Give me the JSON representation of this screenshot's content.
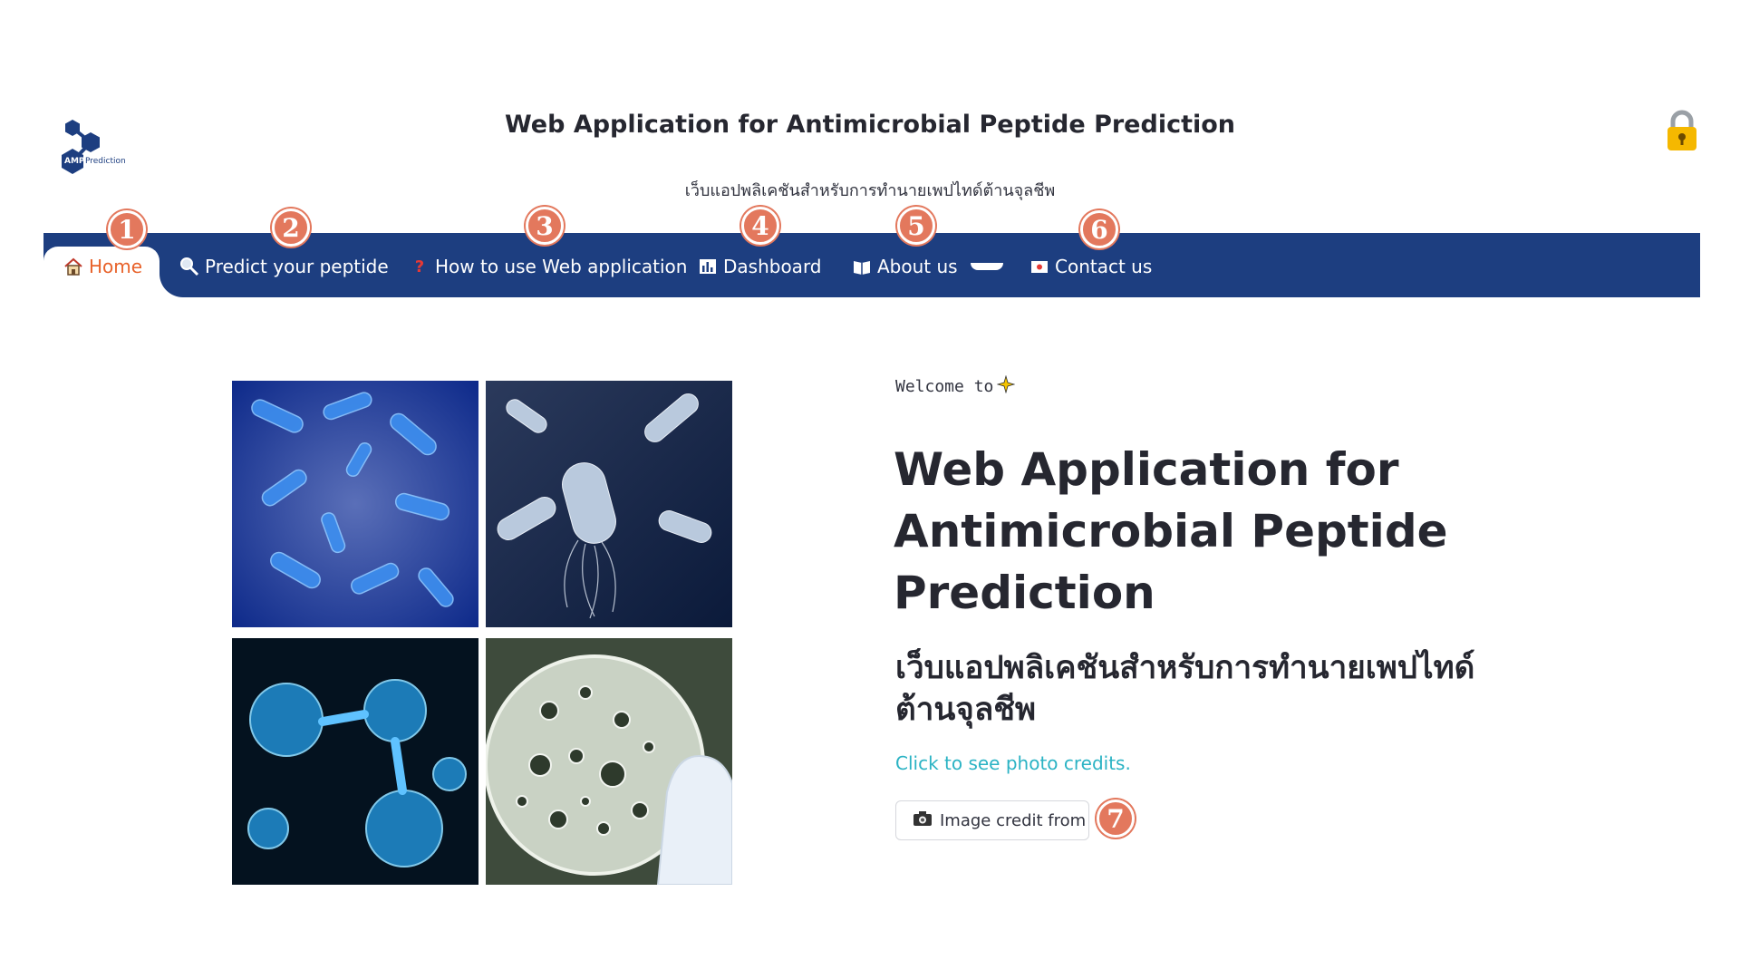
{
  "header": {
    "logo_text": "AMP Prediction",
    "title": "Web Application for Antimicrobial Peptide Prediction",
    "subtitle": "เว็บแอปพลิเคชันสำหรับการทำนายเพปไทด์ต้านจุลชีพ"
  },
  "nav": {
    "items": [
      {
        "label": "Home",
        "icon": "house-icon",
        "badge": "1"
      },
      {
        "label": "Predict your peptide",
        "icon": "magnifier-icon",
        "badge": "2"
      },
      {
        "label": "How to use Web application",
        "icon": "question-mark-icon",
        "badge": "3"
      },
      {
        "label": "Dashboard",
        "icon": "bar-chart-icon",
        "badge": "4"
      },
      {
        "label": "About us",
        "icon": "book-icon",
        "badge": "5"
      },
      {
        "label": "Contact us",
        "icon": "card-icon",
        "badge": "6"
      }
    ],
    "active": "Home"
  },
  "main": {
    "welcome": "Welcome to",
    "title_lines": [
      "Web Application for",
      "Antimicrobial Peptide",
      "Prediction"
    ],
    "thai_lines": [
      "เว็บแอปพลิเคชันสำหรับการทำนายเพปไทด์",
      "ต้านจุลชีพ"
    ],
    "credit_link": "Click to see photo credits.",
    "credit_button": "Image credit from",
    "credit_badge": "7"
  },
  "colors": {
    "nav_bg": "#1d3e80",
    "active": "#e8622a",
    "badge": "#e3785d",
    "link": "#2bb3c4"
  }
}
